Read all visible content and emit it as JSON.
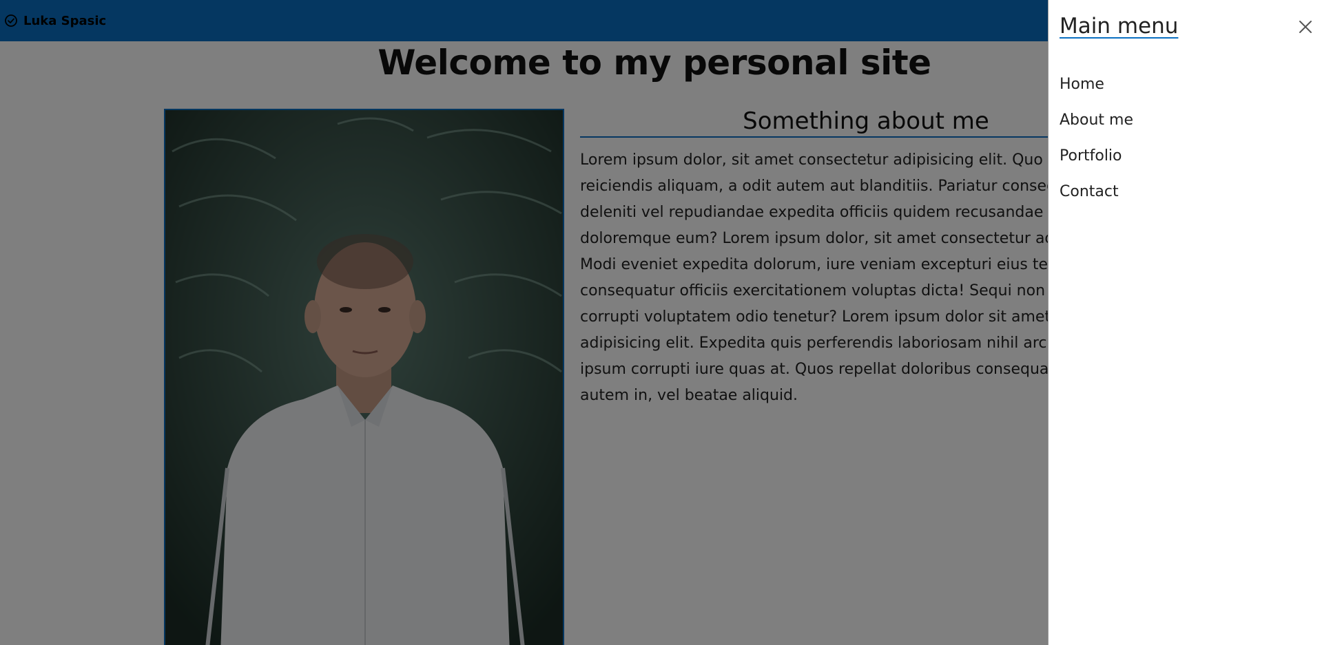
{
  "navbar": {
    "brand_name": "Luka Spasic",
    "brand_icon": "check-circle-icon",
    "color": "#0a6fc2"
  },
  "main": {
    "title": "Welcome to my personal site",
    "about": {
      "heading": "Something about me",
      "text_lines": [
        "Lorem ipsum dolor, sit amet consectetur adipisicing elit. Quo sus",
        "reiciendis aliquam, a odit autem aut blanditiis. Pariatur consequ",
        "deleniti vel repudiandae expedita officiis quidem recusandae am",
        "doloremque eum? Lorem ipsum dolor, sit amet consectetur adip",
        "Modi eveniet expedita dolorum, iure veniam excepturi eius tenet",
        "consequatur officiis exercitationem voluptas dicta! Sequi non exe",
        "corrupti voluptatem odio tenetur? Lorem ipsum dolor sit amet co",
        "adipisicing elit. Expedita quis perferendis laboriosam nihil archite",
        "ipsum corrupti iure quas at. Quos repellat doloribus consequatur",
        "autem in, vel beatae aliquid."
      ]
    }
  },
  "offcanvas": {
    "title": "Main menu",
    "close_icon": "close-icon",
    "items": [
      {
        "label": "Home"
      },
      {
        "label": "About me"
      },
      {
        "label": "Portfolio"
      },
      {
        "label": "Contact"
      }
    ]
  },
  "overlay_color": "rgba(0,0,0,0.5)"
}
